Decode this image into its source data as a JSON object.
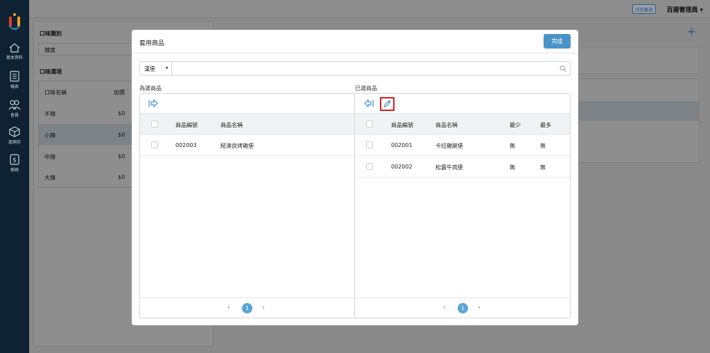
{
  "sidebar": {
    "items": [
      {
        "label": "基本資料",
        "icon": "home-icon"
      },
      {
        "label": "報表",
        "icon": "report-icon"
      },
      {
        "label": "會員",
        "icon": "members-icon"
      },
      {
        "label": "進銷存",
        "icon": "inventory-icon"
      },
      {
        "label": "帳務",
        "icon": "billing-icon"
      }
    ]
  },
  "topbar": {
    "back_label": "回到舊版",
    "admin_label": "百揚管理員 ▾"
  },
  "background": {
    "category_title": "口味類別",
    "category_value": "辣度",
    "options_title": "口味選項",
    "col_name": "口味名稱",
    "col_price": "加價",
    "rows": [
      {
        "name": "不辣",
        "price": "$0"
      },
      {
        "name": "小辣",
        "price": "$0"
      },
      {
        "name": "中辣",
        "price": "$0"
      },
      {
        "name": "大辣",
        "price": "$0"
      }
    ]
  },
  "modal": {
    "title": "套用商品",
    "done_label": "完成",
    "category_select": "漢堡",
    "search_placeholder": "",
    "left": {
      "label": "為選商品",
      "headers": {
        "code": "商品編號",
        "name": "商品名稱"
      },
      "rows": [
        {
          "code": "002003",
          "name": "紐澳良烤雞堡"
        }
      ],
      "page": "1"
    },
    "right": {
      "label": "已選商品",
      "headers": {
        "code": "商品編號",
        "name": "商品名稱",
        "min": "最少",
        "max": "最多"
      },
      "rows": [
        {
          "code": "002001",
          "name": "卡拉雞腿堡",
          "min": "無",
          "max": "無"
        },
        {
          "code": "002002",
          "name": "松露牛肉堡",
          "min": "無",
          "max": "無"
        }
      ],
      "page": "1"
    }
  },
  "colors": {
    "sidebar_bg": "#0f2233",
    "accent": "#4a93c9",
    "highlight": "#e01b1b"
  }
}
